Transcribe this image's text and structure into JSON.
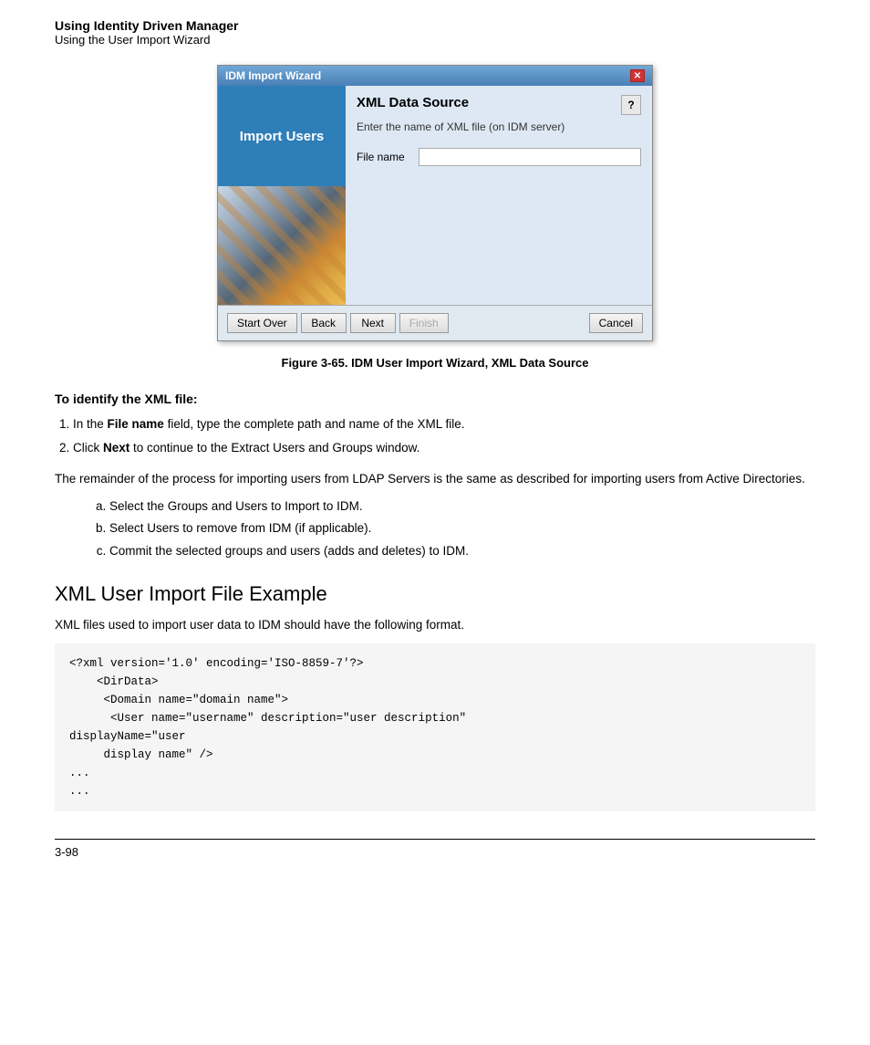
{
  "header": {
    "title_bold": "Using Identity Driven Manager",
    "subtitle": "Using the User Import Wizard"
  },
  "dialog": {
    "title": "IDM Import Wizard",
    "close_btn": "✕",
    "left_panel": {
      "import_users_label": "Import Users"
    },
    "right_panel": {
      "xml_datasource_title": "XML Data Source",
      "help_icon": "?",
      "description": "Enter the name of XML file (on IDM server)",
      "file_name_label": "File name",
      "file_name_value": ""
    },
    "footer": {
      "start_over": "Start Over",
      "back": "Back",
      "next": "Next",
      "finish": "Finish",
      "cancel": "Cancel"
    }
  },
  "figure_caption": "Figure 3-65. IDM User Import Wizard, XML Data Source",
  "section": {
    "heading": "To identify the XML file:",
    "steps": [
      {
        "number": "1.",
        "pre": "In the ",
        "bold": "File name",
        "post": " field, type the complete path and name of the XML file."
      },
      {
        "number": "2.",
        "pre": "Click ",
        "bold": "Next",
        "post": " to continue to the Extract Users and Groups window."
      }
    ],
    "body_para": "The remainder of the process for importing users from LDAP Servers is the same as described for importing users from Active Directories.",
    "alpha_items": [
      "Select the Groups and Users to Import to IDM.",
      "Select Users to remove from IDM (if applicable).",
      "Commit the selected groups and users (adds and deletes) to IDM."
    ]
  },
  "xml_section": {
    "title": "XML User Import File Example",
    "description": "XML files used to import user data to IDM should have the following format.",
    "code": "<?xml version='1.0' encoding='ISO-8859-7'?>\n    <DirData>\n     <Domain name=\"domain name\">\n      <User name=\"username\" description=\"user description\"\ndisplayName=\"user\n     display name\" />\n...\n..."
  },
  "footer": {
    "page_number": "3-98"
  }
}
